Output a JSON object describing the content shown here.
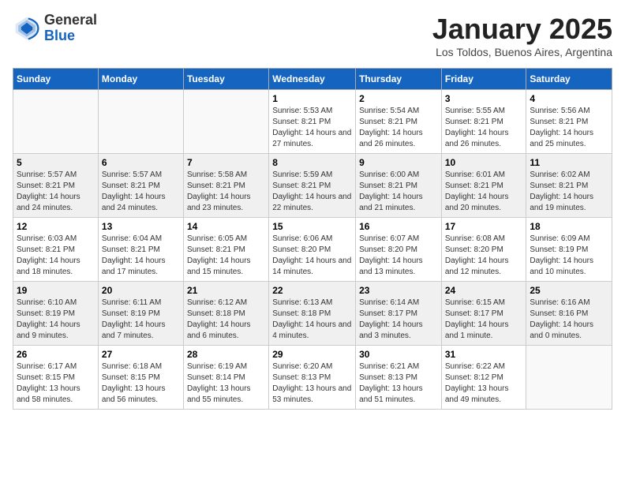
{
  "logo": {
    "general": "General",
    "blue": "Blue"
  },
  "title": "January 2025",
  "subtitle": "Los Toldos, Buenos Aires, Argentina",
  "days_of_week": [
    "Sunday",
    "Monday",
    "Tuesday",
    "Wednesday",
    "Thursday",
    "Friday",
    "Saturday"
  ],
  "weeks": [
    [
      {
        "day": "",
        "info": ""
      },
      {
        "day": "",
        "info": ""
      },
      {
        "day": "",
        "info": ""
      },
      {
        "day": "1",
        "info": "Sunrise: 5:53 AM\nSunset: 8:21 PM\nDaylight: 14 hours and 27 minutes."
      },
      {
        "day": "2",
        "info": "Sunrise: 5:54 AM\nSunset: 8:21 PM\nDaylight: 14 hours and 26 minutes."
      },
      {
        "day": "3",
        "info": "Sunrise: 5:55 AM\nSunset: 8:21 PM\nDaylight: 14 hours and 26 minutes."
      },
      {
        "day": "4",
        "info": "Sunrise: 5:56 AM\nSunset: 8:21 PM\nDaylight: 14 hours and 25 minutes."
      }
    ],
    [
      {
        "day": "5",
        "info": "Sunrise: 5:57 AM\nSunset: 8:21 PM\nDaylight: 14 hours and 24 minutes."
      },
      {
        "day": "6",
        "info": "Sunrise: 5:57 AM\nSunset: 8:21 PM\nDaylight: 14 hours and 24 minutes."
      },
      {
        "day": "7",
        "info": "Sunrise: 5:58 AM\nSunset: 8:21 PM\nDaylight: 14 hours and 23 minutes."
      },
      {
        "day": "8",
        "info": "Sunrise: 5:59 AM\nSunset: 8:21 PM\nDaylight: 14 hours and 22 minutes."
      },
      {
        "day": "9",
        "info": "Sunrise: 6:00 AM\nSunset: 8:21 PM\nDaylight: 14 hours and 21 minutes."
      },
      {
        "day": "10",
        "info": "Sunrise: 6:01 AM\nSunset: 8:21 PM\nDaylight: 14 hours and 20 minutes."
      },
      {
        "day": "11",
        "info": "Sunrise: 6:02 AM\nSunset: 8:21 PM\nDaylight: 14 hours and 19 minutes."
      }
    ],
    [
      {
        "day": "12",
        "info": "Sunrise: 6:03 AM\nSunset: 8:21 PM\nDaylight: 14 hours and 18 minutes."
      },
      {
        "day": "13",
        "info": "Sunrise: 6:04 AM\nSunset: 8:21 PM\nDaylight: 14 hours and 17 minutes."
      },
      {
        "day": "14",
        "info": "Sunrise: 6:05 AM\nSunset: 8:21 PM\nDaylight: 14 hours and 15 minutes."
      },
      {
        "day": "15",
        "info": "Sunrise: 6:06 AM\nSunset: 8:20 PM\nDaylight: 14 hours and 14 minutes."
      },
      {
        "day": "16",
        "info": "Sunrise: 6:07 AM\nSunset: 8:20 PM\nDaylight: 14 hours and 13 minutes."
      },
      {
        "day": "17",
        "info": "Sunrise: 6:08 AM\nSunset: 8:20 PM\nDaylight: 14 hours and 12 minutes."
      },
      {
        "day": "18",
        "info": "Sunrise: 6:09 AM\nSunset: 8:19 PM\nDaylight: 14 hours and 10 minutes."
      }
    ],
    [
      {
        "day": "19",
        "info": "Sunrise: 6:10 AM\nSunset: 8:19 PM\nDaylight: 14 hours and 9 minutes."
      },
      {
        "day": "20",
        "info": "Sunrise: 6:11 AM\nSunset: 8:19 PM\nDaylight: 14 hours and 7 minutes."
      },
      {
        "day": "21",
        "info": "Sunrise: 6:12 AM\nSunset: 8:18 PM\nDaylight: 14 hours and 6 minutes."
      },
      {
        "day": "22",
        "info": "Sunrise: 6:13 AM\nSunset: 8:18 PM\nDaylight: 14 hours and 4 minutes."
      },
      {
        "day": "23",
        "info": "Sunrise: 6:14 AM\nSunset: 8:17 PM\nDaylight: 14 hours and 3 minutes."
      },
      {
        "day": "24",
        "info": "Sunrise: 6:15 AM\nSunset: 8:17 PM\nDaylight: 14 hours and 1 minute."
      },
      {
        "day": "25",
        "info": "Sunrise: 6:16 AM\nSunset: 8:16 PM\nDaylight: 14 hours and 0 minutes."
      }
    ],
    [
      {
        "day": "26",
        "info": "Sunrise: 6:17 AM\nSunset: 8:15 PM\nDaylight: 13 hours and 58 minutes."
      },
      {
        "day": "27",
        "info": "Sunrise: 6:18 AM\nSunset: 8:15 PM\nDaylight: 13 hours and 56 minutes."
      },
      {
        "day": "28",
        "info": "Sunrise: 6:19 AM\nSunset: 8:14 PM\nDaylight: 13 hours and 55 minutes."
      },
      {
        "day": "29",
        "info": "Sunrise: 6:20 AM\nSunset: 8:13 PM\nDaylight: 13 hours and 53 minutes."
      },
      {
        "day": "30",
        "info": "Sunrise: 6:21 AM\nSunset: 8:13 PM\nDaylight: 13 hours and 51 minutes."
      },
      {
        "day": "31",
        "info": "Sunrise: 6:22 AM\nSunset: 8:12 PM\nDaylight: 13 hours and 49 minutes."
      },
      {
        "day": "",
        "info": ""
      }
    ]
  ]
}
